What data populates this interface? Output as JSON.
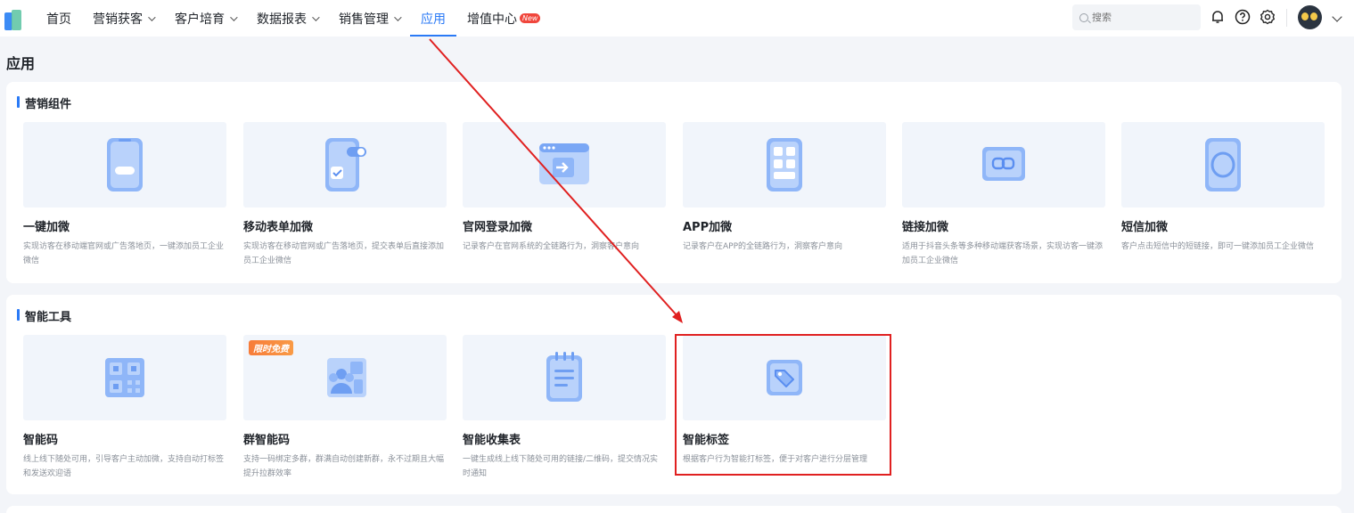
{
  "nav": {
    "items": [
      {
        "label": "首页",
        "dropdown": false,
        "active": false
      },
      {
        "label": "营销获客",
        "dropdown": true,
        "active": false
      },
      {
        "label": "客户培育",
        "dropdown": true,
        "active": false
      },
      {
        "label": "数据报表",
        "dropdown": true,
        "active": false
      },
      {
        "label": "销售管理",
        "dropdown": true,
        "active": false
      },
      {
        "label": "应用",
        "dropdown": false,
        "active": true
      },
      {
        "label": "增值中心",
        "dropdown": false,
        "active": false,
        "badge": "New"
      }
    ],
    "search_placeholder": "搜索",
    "icons": [
      "bell-icon",
      "help-icon",
      "gear-icon"
    ],
    "accent_color": "#2a7af6"
  },
  "page_title": "应用",
  "sections": [
    {
      "title": "营销组件",
      "cards": [
        {
          "title": "一键加微",
          "desc": "实现访客在移动端官网或广告落地页，一键添加员工企业微信",
          "icon": "phone-button-icon"
        },
        {
          "title": "移动表单加微",
          "desc": "实现访客在移动官网或广告落地页，提交表单后直接添加员工企业微信",
          "icon": "phone-form-icon"
        },
        {
          "title": "官网登录加微",
          "desc": "记录客户在官网系统的全链路行为，洞察客户意向",
          "icon": "browser-login-icon"
        },
        {
          "title": "APP加微",
          "desc": "记录客户在APP的全链路行为，洞察客户意向",
          "icon": "app-grid-icon"
        },
        {
          "title": "链接加微",
          "desc": "适用于抖音头条等多种移动端获客场景，实现访客一键添加员工企业微信",
          "icon": "link-icon"
        },
        {
          "title": "短信加微",
          "desc": "客户点击短信中的短链接，即可一键添加员工企业微信",
          "icon": "sms-icon"
        }
      ]
    },
    {
      "title": "智能工具",
      "cards": [
        {
          "title": "智能码",
          "desc": "线上线下随处可用，引导客户主动加微，支持自动打标签和发送欢迎语",
          "icon": "qrcode-icon"
        },
        {
          "title": "群智能码",
          "desc": "支持一码绑定多群，群满自动创建新群，永不过期且大幅提升拉群效率",
          "icon": "group-qrcode-icon",
          "promo": "限时免费"
        },
        {
          "title": "智能收集表",
          "desc": "一键生成线上线下随处可用的链接/二维码，提交情况实时通知",
          "icon": "notepad-icon"
        },
        {
          "title": "智能标签",
          "desc": "根据客户行为智能打标签，便于对客户进行分层管理",
          "icon": "tag-icon",
          "highlighted": true
        }
      ]
    }
  ],
  "annotation": {
    "color": "#e02020"
  }
}
